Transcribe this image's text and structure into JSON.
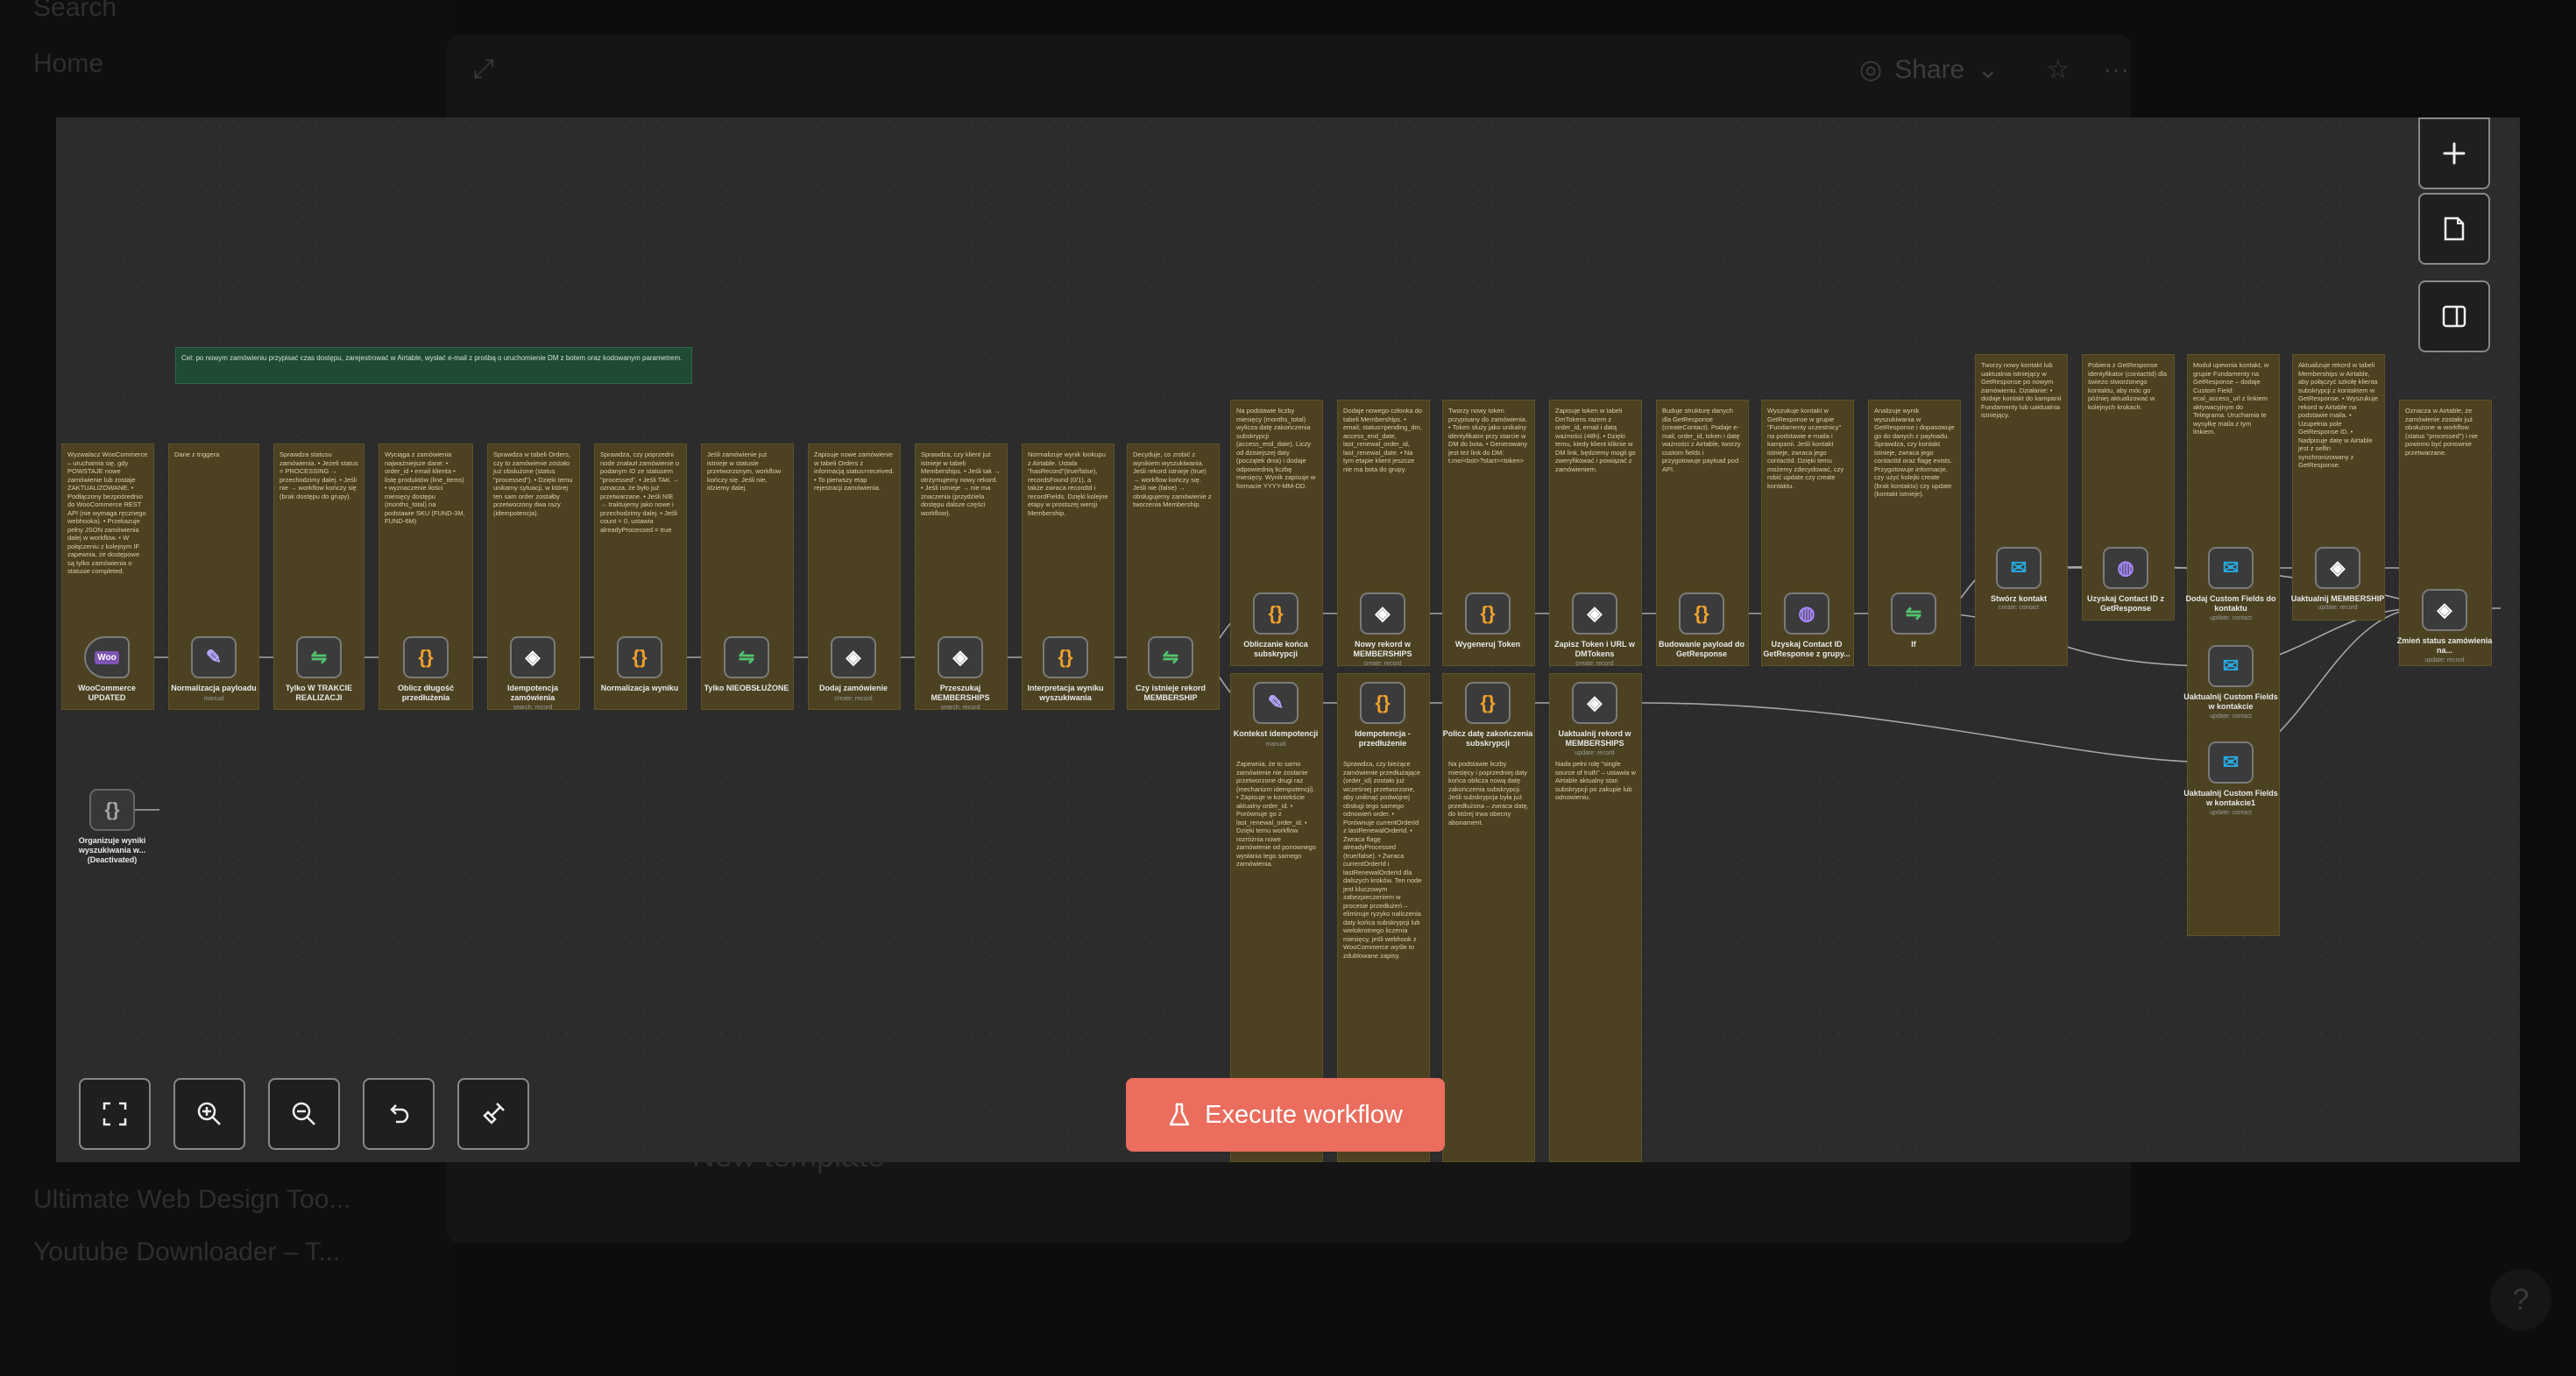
{
  "background": {
    "sidebar_items": [
      "Search",
      "Home",
      "Ultimate Web Design Too...",
      "Youtube Downloader – T..."
    ],
    "share_label": "Share",
    "new_template_label": "New template",
    "help_label": "?"
  },
  "canvas": {
    "execute_label": "Execute workflow",
    "top_sticky": "Cel: po nowym zamówieniu przypisać czas dostępu, zarejestrować w Airtable, wysłać e-mail z prośbą o uruchomienie DM z botem oraz kodowanym parametrem.",
    "main_stickies": [
      "Wyzwalacz WooCommerce – uruchamia się, gdy POWSTAJE nowe zamówienie lub zostaje ZAKTUALIZOWANE. • Podłączony bezpośrednio do WooCommerce REST API (nie wymaga ręcznego webhooka). • Przekazuje pełny JSON zamówienia dalej w workflow. • W połączeniu z kolejnym IF zapewnia, że dostępowe są tylko zamówienia o statusie completed.",
      "Dane z triggera",
      "Sprawdza statusu zamówienia. • Jeżeli status = PROCESSING → przechodzimy dalej. • Jeśli nie → workflow kończy się (brak dostępu do grupy).",
      "Wyciąga z zamówienia najważniejsze dane: • order_id • email klienta • listę produktów (line_items) • wyznaczenie ilości miesięcy dostępu (months_total) na podstawie SKU (FUND-3M, FUND-6M)",
      "Sprawdza w tabeli Orders, czy to zamówienie zostało już obsłużone (status \"processed\"). • Dzięki temu unikamy sytuacji, w której ten sam order zostałby przetworzony dwa razy (idempotencja).",
      "Sprawdza, czy poprzedni node znalazł zamówienie o podanym ID ze statusem \"processed\". • Jeśli TAK → oznacza, że było już przetwarzane. • Jeśli NIE → traktujemy jako nowe i przechodzimy dalej. • Jeśli count = 0, ustawia alreadyProcessed = true",
      "Jeśli zamówienie już istnieje w statusie przetworzonym, workflow kończy się. Jeśli nie, idziemy dalej.",
      "Zapisuje nowe zamówienie w tabeli Orders z informacją status=received. • To pierwszy etap rejestracji zamówienia.",
      "Sprawdza, czy klient już istnieje w tabeli Memberships. • Jeśli tak → otrzymujemy nowy rekord. • Jeśli istnieje → nie ma znaczenia (przydziela dostępu dalsze części workflow).",
      "Normalizuje wynik lookupu z Airtable. Ustala \"hasRecord\"(true/false), recordsFound (0/1), a także zwraca recordId i recordFields. Dzięki kolejne etapy w prostszej wersji Membership.",
      "Decyduje, co zrobić z wynikiem wyszukiwania. Jeśli rekord istnieje (true) → workflow kończy się. Jeśli nie (false) → obsługujemy zamówienie z tworzenia Membership."
    ],
    "upper_stickies": [
      "Na podstawie liczby miesięcy (months_total) wylicza datę zakończenia subskrypcji (access_end_date). Liczy od dzisiejszej daty (początek dnia) i dodaje odpowiednią liczbę miesięcy. Wynik zapisuje w formacie YYYY-MM-DD.",
      "Dodaje nowego członka do tabeli Memberships. • email, status=pending_dm, access_end_date, last_renewal_order_id, last_renewal_date. • Na tym etapie klient jeszcze nie ma bota do grupy.",
      "Tworzy nowy token przypisany do zamówienia. • Token służy jako unikalny identyfikator przy starcie w DM do bota. • Generowany jest też link do DM: t.me/<bot>?start=<token>",
      "Zapisuje token w tabeli DmTokens razem z order_id, email i datą ważności (48h). • Dzięki temu, kiedy klient kliknie w DM link, będziemy mogli go zweryfikować i powiązać z zamówieniem.",
      "Buduje strukturę danych dla GetResponse (createContact). Podaje e-mail, order_id, token i datę ważności z Airtable, tworzy custom fields i przygotowuje payload pod API.",
      "Wyszukuje kontakt w GetResponse w grupie \"Fundamenty uczestnicy\" na podstawie e-maila i kampanii. Jeśli kontakt istnieje, zwraca jego contactId. Dzięki temu możemy zdecydować, czy robić update czy create kontaktu.",
      "Analizuje wynik wyszukiwania w GetResponse i dopasowuje go do danych z payloadu. Sprawdza, czy kontakt istnieje, zwraca jego contactId oraz flagę exists. Przygotowuje informacje, czy użyć kolejki create (brak kontaktu) czy update (kontakt istnieje)."
    ],
    "right_stickies": [
      "Tworzy nowy kontakt lub uaktualnia istniejący w GetResponse po nowym zamówieniu. Działanie: • dodaje kontakt do kampanii Fundamenty lub uaktualnia istniejący.",
      "Pobiera z GetResponse identyfikator (contactId) dla świeżo stworzonego kontaktu, aby móc go później aktualizować w kolejnych krokach.",
      "Moduł upewnia kontakt, w grupie Fundamenty na GetResponse – dodaje Custom Field: ecal_access_url z linkiem aktywacyjnym do Telegrama. Uruchamia te wysyłkę maila z tym linkiem.",
      "Aktualizuje rekord w tabeli Memberships w Airtable, aby połączyć szkołę klienta subskrypcji z kontaktem w GetResponse. • Wyszukuje rekord w Airtable na podstawie maila. • Uzupełnia pole GetResponse ID. • Nadpisuje datę w Airtable jest z selfin synchronizowany z GetResponse.",
      "Oznacza w Airtable, że zamówienie zostało już obsłużone w workflow (status \"processed\") i nie powinno być ponownie przetwarzane."
    ],
    "lower_stickies": [
      "Zapewnia, że to samo zamówienie nie zostanie przetworzone drugi raz (mechanizm idempotencji). • Zapisuje w kontekście aktualny order_id. • Porównuje go z last_renewal_order_id. • Dzięki temu workflow rozróżnia nowe zamówienie od ponownego wysłania tego samego zamówienia.",
      "Sprawdza, czy bieżące zamówienie przedłużające (order_id) zostało już wcześniej przetworzone, aby uniknąć podwójnej obsługi tego samego odnowień order. • Porównuje currentOrderId z lastRenewalOrderId. • Zwraca flagę alreadyProcessed (true/false). • Zwraca currentOrderId i lastRenewalOrderId dla dalszych kroków. Ten node jest kluczowym zabezpieczeniem w procesie przedłużeń – eliminuje ryzyko naliczenia daty końca subskrypcji lub wielokrotnego liczenia miesięcy, jeśli webhook z WooCommerce wyśle to zdublowane zapisy.",
      "Na podstawie liczby miesięcy i poprzedniej daty końca oblicza nową datę zakończenia subskrypcji. Jeśli subskrypcja była już przedłużona – zwraca datę, do której trwa obecny abonament.",
      "Nada pełni rolę \"single source of truth\" – ustawia w Airtable aktualny stan subskrypcji po zakupie lub odnowieniu."
    ],
    "nodes": {
      "woo": {
        "label": "WooCommerce UPDATED",
        "sub": ""
      },
      "norm": {
        "label": "Normalizacja payloadu",
        "sub": "manual"
      },
      "tylko_trakcie": {
        "label": "Tylko W TRAKCIE REALIZACJI",
        "sub": ""
      },
      "oblicz": {
        "label": "Oblicz długość przedłużenia",
        "sub": ""
      },
      "idem_zam": {
        "label": "Idempotencja zamówienia",
        "sub": "search: record"
      },
      "norm_wyn": {
        "label": "Normalizacja wyniku",
        "sub": ""
      },
      "tylko_nie": {
        "label": "Tylko NIEOBSŁUŻONE",
        "sub": ""
      },
      "dodaj_zam": {
        "label": "Dodaj zamówienie",
        "sub": "create: record"
      },
      "przeszukaj": {
        "label": "Przeszukaj MEMBERSHIPS",
        "sub": "search: record"
      },
      "interp": {
        "label": "Interpretacja wyniku wyszukiwania",
        "sub": ""
      },
      "czy_ist": {
        "label": "Czy istnieje rekord MEMBERSHIP",
        "sub": ""
      },
      "obl_konca": {
        "label": "Obliczanie końca subskrypcji",
        "sub": ""
      },
      "nowy_rek": {
        "label": "Nowy rekord w MEMBERSHIPS",
        "sub": "create: record"
      },
      "wygeneruj": {
        "label": "Wygeneruj Token",
        "sub": ""
      },
      "zapisz_tok": {
        "label": "Zapisz Token i URL w DMTokens",
        "sub": "create: record"
      },
      "budowanie": {
        "label": "Budowanie payload do GetResponse",
        "sub": ""
      },
      "uzyskaj_grupy": {
        "label": "Uzyskaj Contact ID GetResponse z grupy...",
        "sub": ""
      },
      "if": {
        "label": "If",
        "sub": ""
      },
      "stworz": {
        "label": "Stwórz kontakt",
        "sub": "create: contact"
      },
      "uzyskaj_id": {
        "label": "Uzyskaj Contact ID z GetResponse",
        "sub": ""
      },
      "dodaj_cf": {
        "label": "Dodaj Custom Fields do kontaktu",
        "sub": "update: contact"
      },
      "uakt_mem": {
        "label": "Uaktualnij MEMBERSHIP",
        "sub": "update: record"
      },
      "zmien": {
        "label": "Zmień status zamówienia na...",
        "sub": "update: record"
      },
      "uakt_cf1": {
        "label": "Uaktualnij Custom Fields w kontakcie",
        "sub": "update: contact"
      },
      "uakt_cf2": {
        "label": "Uaktualnij Custom Fields w kontakcie1",
        "sub": "update: contact"
      },
      "kontekst": {
        "label": "Kontekst idempotencji",
        "sub": "manual"
      },
      "idem_prz": {
        "label": "Idempotencja - przedłużenie",
        "sub": ""
      },
      "policz": {
        "label": "Policz datę zakończenia subskrypcji",
        "sub": ""
      },
      "uakt_rek": {
        "label": "Uaktualnij rekord w MEMBERSHIPS",
        "sub": "update: record"
      },
      "organizuje": {
        "label": "Organizuje wyniki wyszukiwania w... (Deactivated)",
        "sub": ""
      }
    }
  },
  "colors": {
    "execute_bg": "#ea6d5d",
    "sticky_bg": "#4c4222",
    "sticky_green_bg": "#1f4a34",
    "canvas_bg": "#2c2c2c"
  },
  "icons": {
    "toolbar": [
      "fit-view-icon",
      "zoom-in-icon",
      "zoom-out-icon",
      "undo-icon",
      "tidy-up-icon"
    ],
    "right_panel": [
      "plus-icon",
      "sticky-note-icon",
      "panel-icon"
    ],
    "execute": "flask-icon"
  }
}
